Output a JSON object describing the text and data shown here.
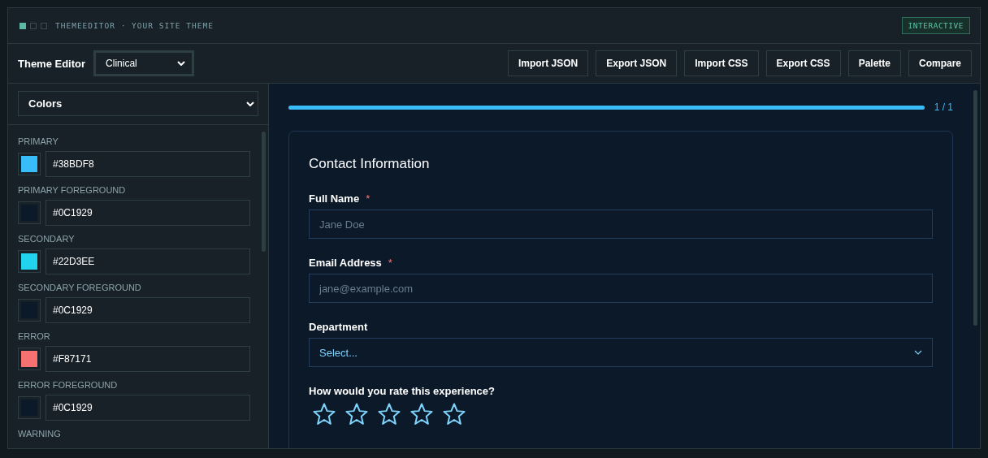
{
  "header": {
    "title": "THEMEEDITOR · YOUR SITE THEME",
    "badge": "INTERACTIVE"
  },
  "toolbar": {
    "title": "Theme Editor",
    "theme_select": "Clinical",
    "buttons": [
      "Import JSON",
      "Export JSON",
      "Import CSS",
      "Export CSS",
      "Palette",
      "Compare"
    ]
  },
  "sidebar": {
    "section_select": "Colors",
    "colors": [
      {
        "label": "PRIMARY",
        "value": "#38BDF8",
        "color": "#38bdf8"
      },
      {
        "label": "PRIMARY FOREGROUND",
        "value": "#0C1929",
        "color": "#0c1929"
      },
      {
        "label": "SECONDARY",
        "value": "#22D3EE",
        "color": "#22d3ee"
      },
      {
        "label": "SECONDARY FOREGROUND",
        "value": "#0C1929",
        "color": "#0c1929"
      },
      {
        "label": "ERROR",
        "value": "#F87171",
        "color": "#f87171"
      },
      {
        "label": "ERROR FOREGROUND",
        "value": "#0C1929",
        "color": "#0c1929"
      },
      {
        "label": "WARNING"
      }
    ]
  },
  "preview": {
    "progress": {
      "level": 1,
      "reading": "1 / 1"
    },
    "form": {
      "title": "Contact Information",
      "fields": [
        {
          "kind": "text",
          "label": "Full Name",
          "required_mark": "*",
          "placeholder": "Jane Doe"
        },
        {
          "kind": "text",
          "label": "Email Address",
          "required_mark": "*",
          "placeholder": "jane@example.com"
        },
        {
          "kind": "select",
          "label": "Department",
          "value": "Select..."
        },
        {
          "kind": "rating",
          "label": "How would you rate this experience?",
          "stars": 0
        }
      ]
    }
  }
}
